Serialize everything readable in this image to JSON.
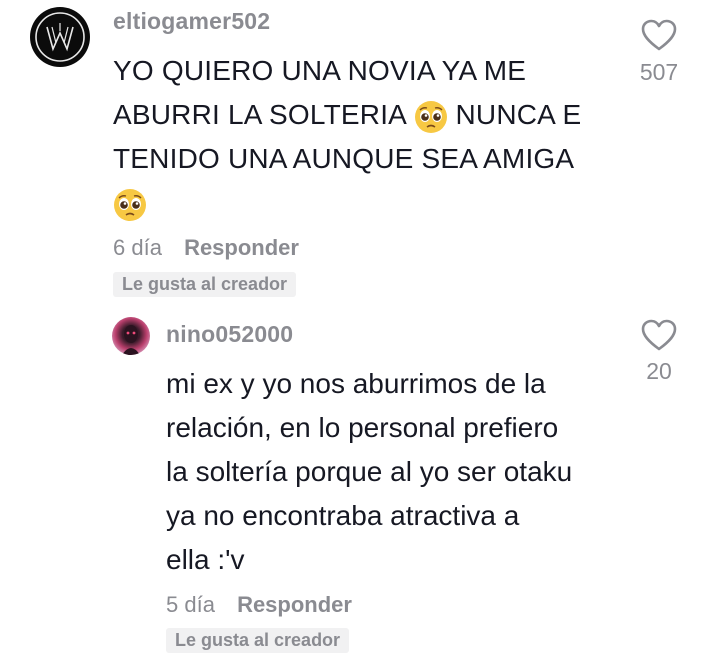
{
  "comments": [
    {
      "username": "eltiogamer502",
      "lines": [
        "YO QUIERO UNA NOVIA YA ME",
        "ABURRI LA SOLTERIA",
        "NUNCA E",
        "TENIDO UNA AUNQUE SEA AMIGA"
      ],
      "emoji": "pleading-face",
      "time": "6 día",
      "reply_label": "Responder",
      "badge": "Le gusta al creador",
      "likes": "507"
    },
    {
      "username": "nino052000",
      "lines": [
        "mi ex y yo nos aburrimos de la",
        "relación, en lo personal prefiero",
        "la soltería porque al yo ser otaku",
        "ya no encontraba atractiva a",
        "ella :'v"
      ],
      "time": "5 día",
      "reply_label": "Responder",
      "badge": "Le gusta al creador",
      "likes": "20"
    }
  ],
  "colors": {
    "text": "#161823",
    "secondary": "#8a8b91",
    "badge_bg": "#f1f1f2"
  }
}
